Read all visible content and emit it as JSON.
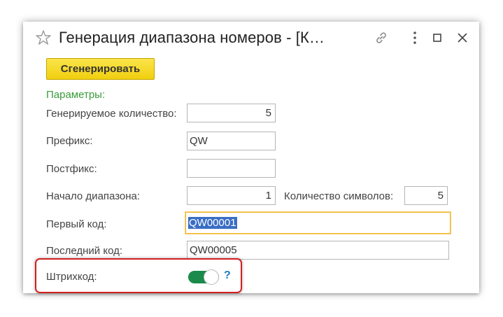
{
  "window": {
    "title": "Генерация диапазона номеров - [К…",
    "icons": [
      "star-icon",
      "link-icon",
      "more-icon",
      "maximize-icon",
      "close-icon"
    ]
  },
  "toolbar": {
    "generate_label": "Сгенерировать"
  },
  "section": {
    "label": "Параметры:"
  },
  "fields": {
    "quantity": {
      "label": "Генерируемое количество:",
      "value": "5"
    },
    "prefix": {
      "label": "Префикс:",
      "value": "QW"
    },
    "postfix": {
      "label": "Постфикс:",
      "value": ""
    },
    "range_start": {
      "label": "Начало диапазона:",
      "value": "1"
    },
    "char_count": {
      "label": "Количество символов:",
      "value": "5"
    },
    "first_code": {
      "label": "Первый код:",
      "value": "QW00001"
    },
    "last_code": {
      "label": "Последний код:",
      "value": "QW00005"
    },
    "barcode": {
      "label": "Штрихкод:",
      "enabled": true,
      "help": "?"
    }
  },
  "colors": {
    "accent_button": "#f5d520",
    "section_label": "#3a9a3a",
    "toggle_on": "#1c8a4a",
    "focus_border": "#f2b32a",
    "highlight_frame": "#d22020",
    "help": "#1e7bc0"
  }
}
